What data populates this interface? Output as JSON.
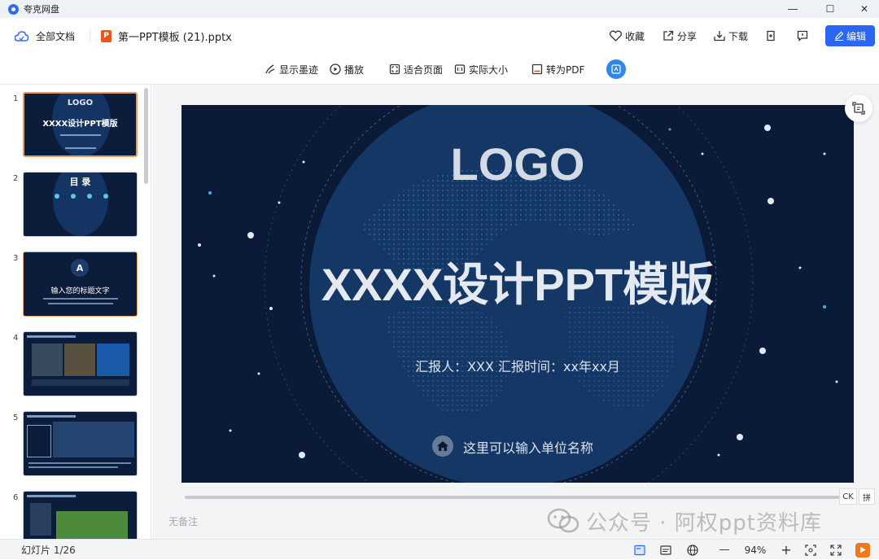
{
  "app": {
    "title": "夸克网盘"
  },
  "window": {
    "minimize": "—",
    "maximize": "☐",
    "close": "✕"
  },
  "header": {
    "all_docs": "全部文档",
    "file_icon_letter": "P",
    "file_name": "第一PPT模板 (21).pptx",
    "collect": "收藏",
    "share": "分享",
    "download": "下载",
    "edit": "编辑"
  },
  "toolbar": {
    "ink": "显示墨迹",
    "play": "播放",
    "fit_page": "适合页面",
    "actual_size": "实际大小",
    "to_pdf": "转为PDF"
  },
  "sidebar": {
    "thumbs": [
      {
        "num": "1",
        "title": "LOGO",
        "subtitle": "XXXX设计PPT模版"
      },
      {
        "num": "2",
        "title": "目 录"
      },
      {
        "num": "3",
        "title": "A",
        "subtitle": "输入您的标题文字"
      },
      {
        "num": "4"
      },
      {
        "num": "5"
      },
      {
        "num": "6"
      }
    ]
  },
  "slide": {
    "logo": "LOGO",
    "title": "XXXX设计PPT模版",
    "reporter": "汇报人：XXX  汇报时间：xx年xx月",
    "unit": "这里可以输入单位名称"
  },
  "notes": {
    "placeholder": "无备注"
  },
  "ime": {
    "lang": "CK",
    "mode": "拼"
  },
  "status": {
    "slide_count": "幻灯片 1/26",
    "zoom": "94%"
  },
  "watermark": {
    "text": "公众号 · 阿权ppt资料库"
  },
  "colors": {
    "accent": "#2b66f6",
    "slide_bg": "#0a1a37",
    "globe": "#163a6e"
  }
}
